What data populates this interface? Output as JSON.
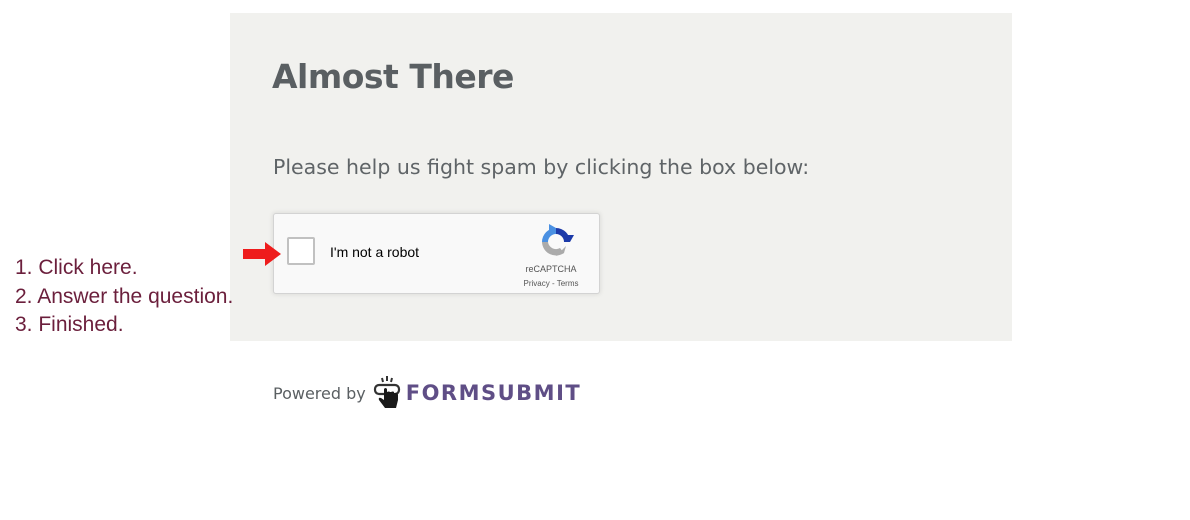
{
  "page": {
    "title": "Almost There",
    "subtitle": "Please help us fight spam by clicking the box below:"
  },
  "recaptcha": {
    "checkbox_label": "I'm not a robot",
    "checked": false,
    "brand": "reCAPTCHA",
    "privacy_link": "Privacy",
    "separator": " - ",
    "terms_link": "Terms",
    "logo_icon": "recaptcha-logo-icon"
  },
  "annotation": {
    "arrow_icon": "red-arrow-right-icon",
    "arrow_color": "#ee1c1c",
    "steps": [
      "1. Click here.",
      "2. Answer the question.",
      "3. Finished."
    ],
    "text_color": "#6b1f3c"
  },
  "footer": {
    "powered_by": "Powered by",
    "brand_icon": "pointing-hand-icon",
    "brand_name": "FORMSUBMIT",
    "brand_color": "#5f4e86"
  },
  "colors": {
    "panel_background": "#f1f1ee",
    "heading_text": "#5a5f62"
  }
}
